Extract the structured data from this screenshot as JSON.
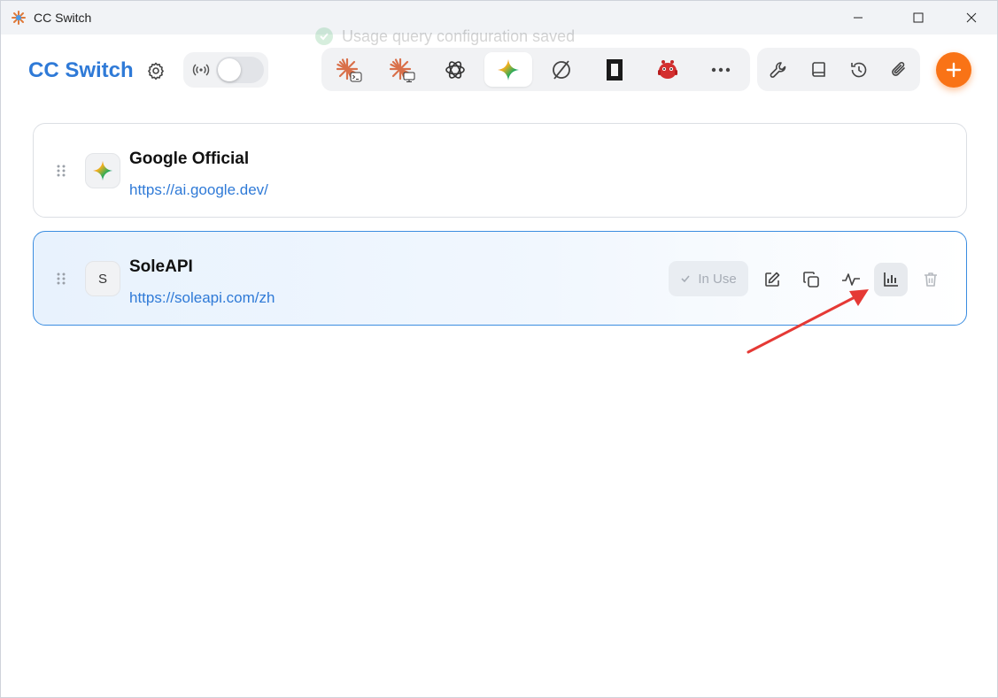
{
  "window": {
    "title": "CC Switch",
    "controls": [
      "minimize-icon",
      "maximize-icon",
      "close-icon"
    ]
  },
  "toast": {
    "message": "Usage query configuration saved",
    "icon": "check-circle-icon",
    "color": "#22a34a"
  },
  "header": {
    "brand": "CC Switch",
    "brand_color": "#2f7ad7",
    "settings_icon": "gear-icon",
    "proxy_toggle": {
      "icon": "signal-icon",
      "on": false
    },
    "apps": [
      {
        "icon": "claude-terminal-icon",
        "active": false
      },
      {
        "icon": "claude-desktop-icon",
        "active": false
      },
      {
        "icon": "openai-icon",
        "active": false
      },
      {
        "icon": "gemini-icon",
        "active": true
      },
      {
        "icon": "opencode-icon",
        "active": false
      },
      {
        "icon": "dark-tile-icon",
        "active": false
      },
      {
        "icon": "red-robot-icon",
        "active": false
      },
      {
        "icon": "more-icon",
        "active": false
      }
    ],
    "utilities": [
      "wrench-icon",
      "book-icon",
      "history-icon",
      "paperclip-icon"
    ],
    "add_icon": "plus-icon",
    "add_color": "#f97316"
  },
  "providers": [
    {
      "name": "Google Official",
      "url": "https://ai.google.dev/",
      "avatar_icon": "gemini-icon",
      "active": false
    },
    {
      "name": "SoleAPI",
      "url": "https://soleapi.com/zh",
      "avatar_letter": "S",
      "active": true,
      "status_label": "In Use",
      "actions": [
        "edit-icon",
        "copy-icon",
        "pulse-icon",
        "bar-chart-icon",
        "trash-icon"
      ]
    }
  ],
  "annotation": {
    "type": "arrow",
    "color": "#e53935",
    "target": "bar-chart-icon"
  }
}
